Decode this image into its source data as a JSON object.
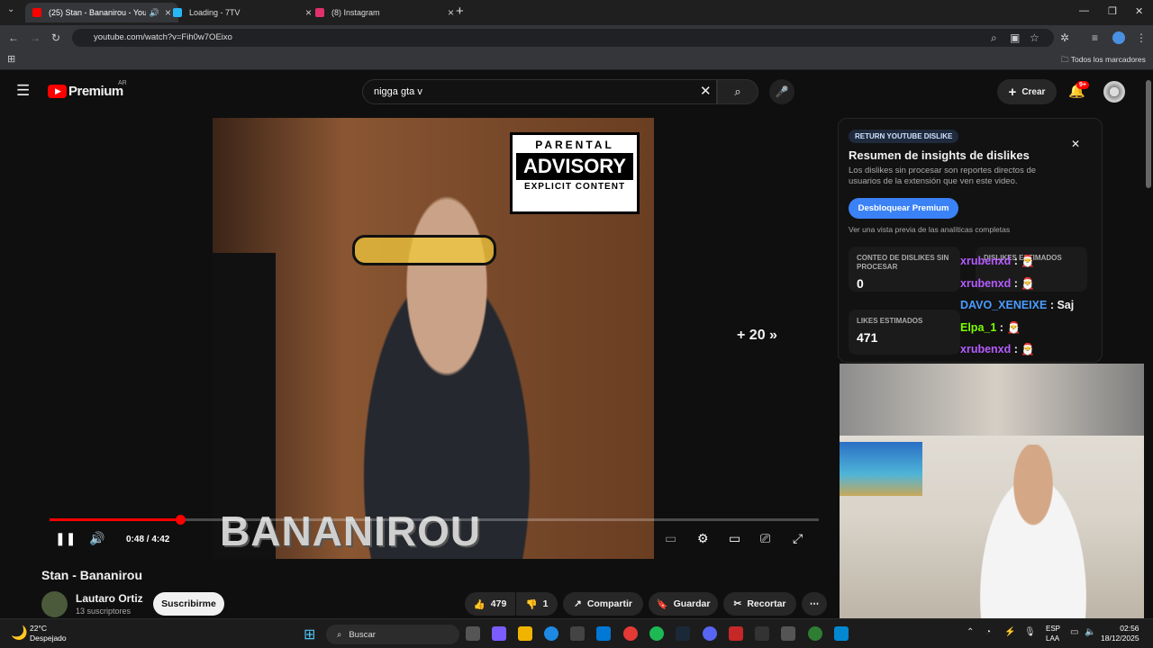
{
  "browser": {
    "tabs": [
      {
        "title": "(25) Stan - Bananirou - You",
        "color": "#ff0000"
      },
      {
        "title": "Loading - 7TV",
        "color": "#29b6f6"
      },
      {
        "title": "(8) Instagram",
        "color": "#e1306c"
      }
    ],
    "url": "youtube.com/watch?v=Fih0w7OEixo",
    "bookmarks_label": "Todos los marcadores"
  },
  "youtube": {
    "logo": "Premium",
    "country": "AR",
    "search_value": "nigga gta v",
    "create_label": "Crear",
    "notification_count": "9+"
  },
  "video": {
    "parental_1": "PARENTAL",
    "parental_2": "ADVISORY",
    "parental_3": "EXPLICIT CONTENT",
    "watermark": "BANANIROU",
    "skip_label": "+ 20",
    "time": "0:48 / 4:42",
    "progress": 0.17,
    "title": "Stan - Bananirou",
    "channel": "Lautaro Ortiz",
    "subscribers": "13 suscriptores",
    "subscribe_label": "Suscribirme",
    "likes": "479",
    "dislikes": "1",
    "share_label": "Compartir",
    "save_label": "Guardar",
    "clip_label": "Recortar"
  },
  "ryd": {
    "badge": "RETURN YOUTUBE DISLIKE",
    "title": "Resumen de insights de dislikes",
    "description": "Los dislikes sin procesar son reportes directos de usuarios de la extensión que ven este video.",
    "button": "Desbloquear Premium",
    "preview": "Ver una vista previa de las analíticas completas",
    "raw_label": "CONTEO DE DISLIKES SIN PROCESAR",
    "raw_value": "0",
    "likes_label": "LIKES ESTIMADOS",
    "likes_value": "471",
    "est_label": "DISLIKES ESTIMADOS"
  },
  "chat": [
    {
      "user": "xrubenxd",
      "msg": ":",
      "color": "#b45cff"
    },
    {
      "user": "xrubenxd",
      "msg": ":",
      "color": "#b45cff"
    },
    {
      "user": "DAVO_XENEIXE",
      "msg": ": Saj",
      "color": "#4a9cff"
    },
    {
      "user": "Elpa_1",
      "msg": ":",
      "color": "#7cfc00"
    },
    {
      "user": "xrubenxd",
      "msg": ":",
      "color": "#b45cff"
    }
  ],
  "taskbar": {
    "temp": "22°C",
    "weather": "Despejado",
    "search_label": "Buscar",
    "lang1": "ESP",
    "lang2": "LAA",
    "time": "02:56",
    "date": "18/12/2025"
  }
}
